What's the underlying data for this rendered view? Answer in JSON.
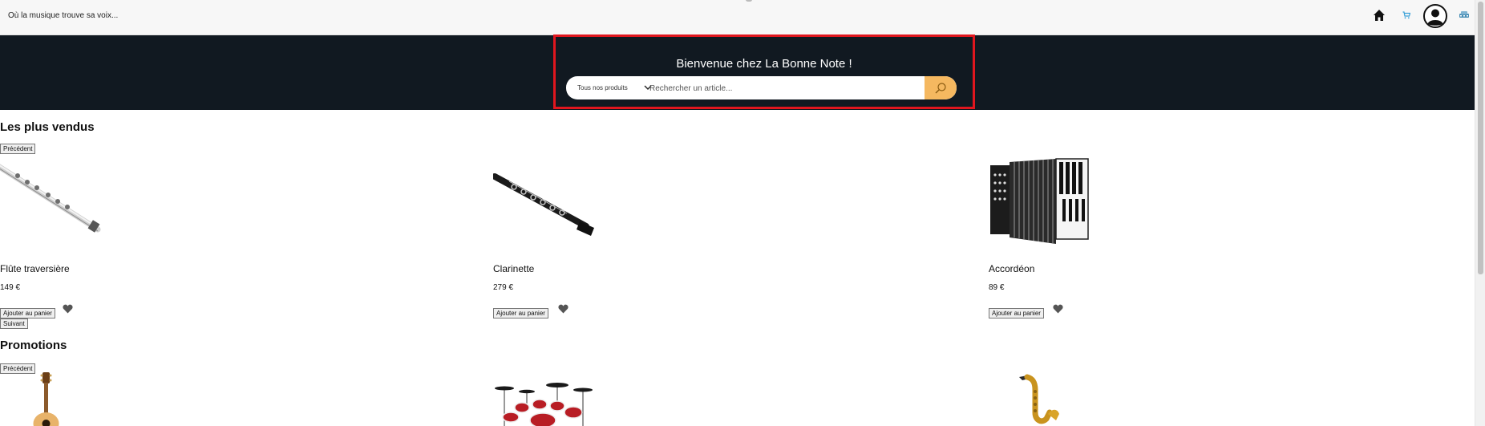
{
  "header": {
    "tagline": "Où la musique trouve sa voix...",
    "icons": [
      "home-icon",
      "cart-icon",
      "user-avatar-icon",
      "extra-icon"
    ]
  },
  "hero": {
    "title": "Bienvenue chez La Bonne Note !",
    "search": {
      "category": "Tous nos produits",
      "placeholder": "Rechercher un article...",
      "button_icon": "search-icon"
    },
    "highlight_color": "#e0161e",
    "background_color": "#111921",
    "accent_color": "#f5b860"
  },
  "bestsellers": {
    "title": "Les plus vendus",
    "prev_label": "Précédent",
    "next_label": "Suivant",
    "products": [
      {
        "name": "Flûte traversière",
        "price": "149 €",
        "add_label": "Ajouter au panier",
        "image": "flute-image"
      },
      {
        "name": "Clarinette",
        "price": "279 €",
        "add_label": "Ajouter au panier",
        "image": "clarinet-image"
      },
      {
        "name": "Accordéon",
        "price": "89 €",
        "add_label": "Ajouter au panier",
        "image": "accordion-image"
      }
    ]
  },
  "promotions": {
    "title": "Promotions",
    "prev_label": "Précédent",
    "products": [
      {
        "image": "guitar-image"
      },
      {
        "image": "drum-kit-image"
      },
      {
        "image": "saxophone-image"
      }
    ]
  }
}
